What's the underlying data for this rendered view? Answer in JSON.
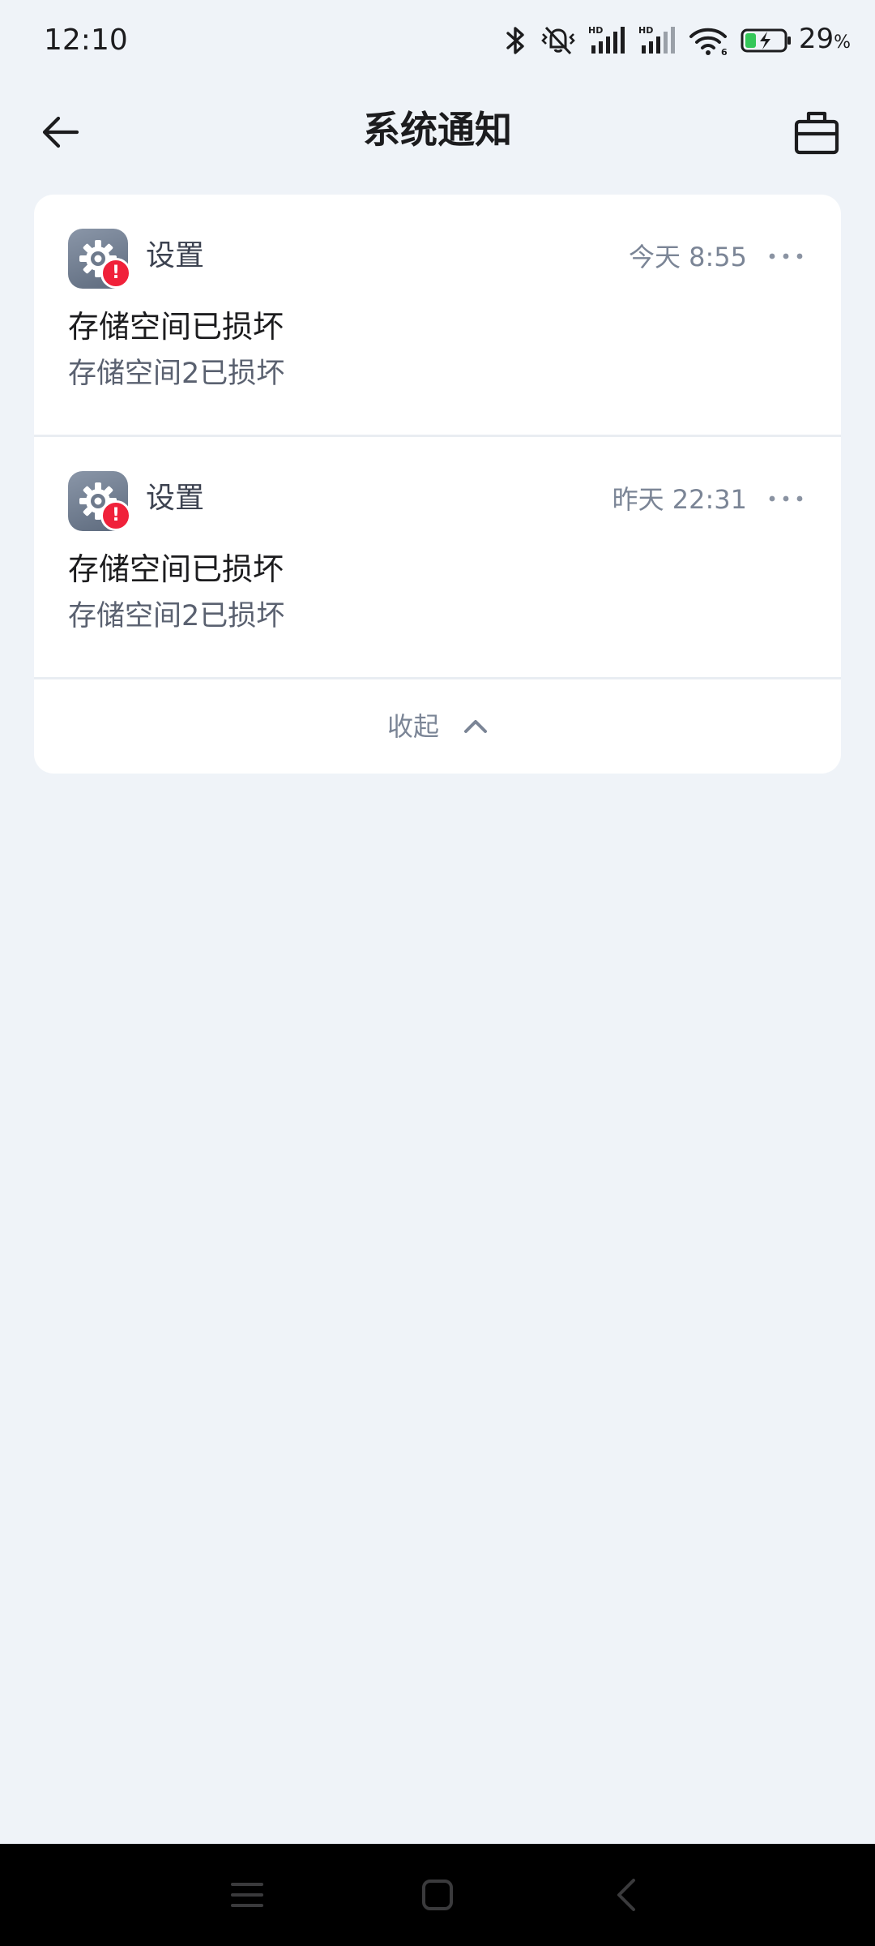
{
  "status_bar": {
    "time": "12:10",
    "battery_percent": "29",
    "battery_unit": "%",
    "battery_level": 0.29,
    "icons": [
      "bluetooth-icon",
      "mute-vibrate-icon",
      "hd-signal-icon",
      "hd-signal-icon",
      "wifi-6-icon",
      "battery-charging-icon"
    ]
  },
  "header": {
    "title": "系统通知",
    "back_icon": "arrow-left-icon",
    "right_icon": "toolbox-icon"
  },
  "notifications": [
    {
      "app_name": "设置",
      "time": "今天 8:55",
      "title": "存储空间已损坏",
      "body": "存储空间2已损坏",
      "badge": "!"
    },
    {
      "app_name": "设置",
      "time": "昨天 22:31",
      "title": "存储空间已损坏",
      "body": "存储空间2已损坏",
      "badge": "!"
    }
  ],
  "collapse": {
    "label": "收起"
  },
  "colors": {
    "page_background": "#eff3f8",
    "card_background": "#ffffff",
    "badge_red": "#f0213a",
    "secondary_text": "#7b8596",
    "nav_bar": "#000000"
  }
}
